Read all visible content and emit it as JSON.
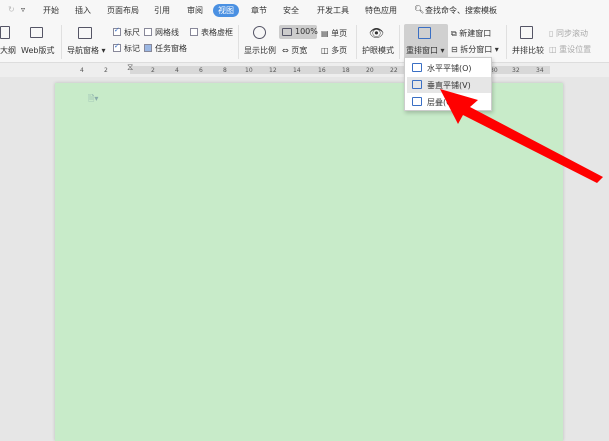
{
  "tabs": [
    "开始",
    "插入",
    "页面布局",
    "引用",
    "审阅",
    "视图",
    "章节",
    "安全",
    "开发工具",
    "特色应用"
  ],
  "active_tab": "视图",
  "search": "查找命令、搜索模板",
  "toolbar": {
    "outline": "大纲",
    "web": "Web版式",
    "nav": "导航窗格",
    "ruler": "标尺",
    "grid": "网格线",
    "table_grid": "表格虚框",
    "mark": "标记",
    "task": "任务窗格",
    "zoom": "显示比例",
    "zoom_pct": "100%",
    "page_width": "页宽",
    "single": "单页",
    "multi": "多页",
    "eye": "护眼模式",
    "arrange": "重排窗口",
    "new_win": "新建窗口",
    "split": "拆分窗口",
    "side": "并排比较",
    "sync": "同步滚动",
    "reset": "重设位置"
  },
  "ruler_ticks": [
    "4",
    "2",
    "2",
    "4",
    "6",
    "8",
    "10",
    "12",
    "14",
    "16",
    "18",
    "20",
    "22",
    "30",
    "32",
    "34"
  ],
  "menu": {
    "items": [
      "水平平铺(O)",
      "垂直平铺(V)",
      "层叠(C)"
    ],
    "highlighted": 1
  },
  "colors": {
    "accent": "#4a90e2",
    "page": "#c8ebc9",
    "arrow": "#ff0000"
  }
}
